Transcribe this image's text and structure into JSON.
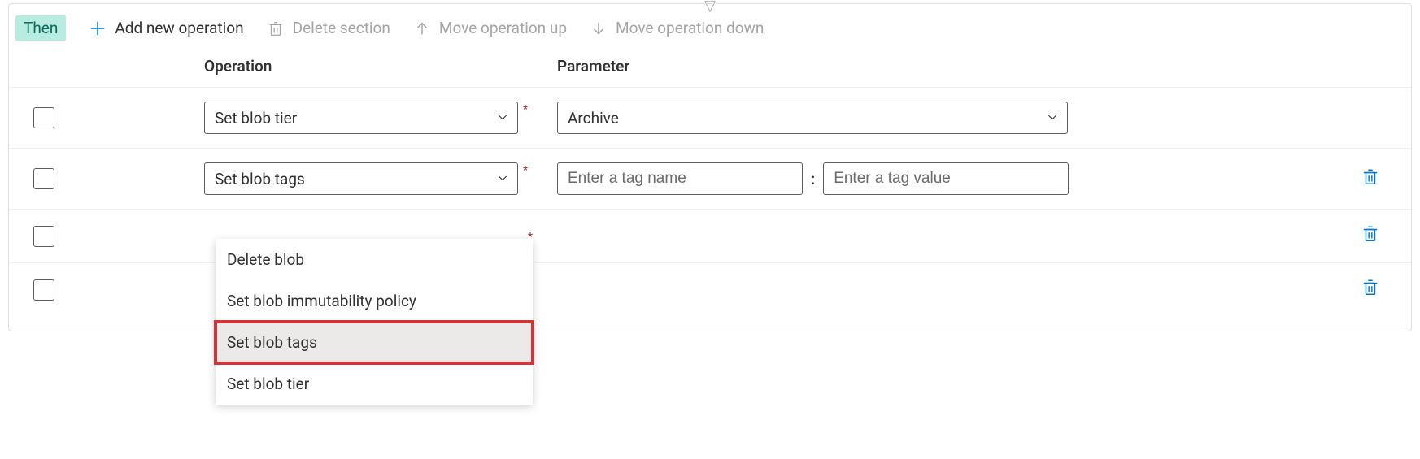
{
  "top_arrow_glyph": "▽",
  "badge": {
    "label": "Then"
  },
  "toolbar": {
    "add": {
      "label": "Add new operation"
    },
    "delete": {
      "label": "Delete section"
    },
    "moveup": {
      "label": "Move operation up"
    },
    "movedn": {
      "label": "Move operation down"
    }
  },
  "headers": {
    "operation": "Operation",
    "parameter": "Parameter"
  },
  "rows": [
    {
      "operation_selected": "Set blob tier",
      "parameter_kind": "select",
      "parameter_selected": "Archive",
      "show_trash": false
    },
    {
      "operation_selected": "Set blob tags",
      "parameter_kind": "tag",
      "tag_name_placeholder": "Enter a tag name",
      "tag_value_placeholder": "Enter a tag value",
      "tag_separator": ":",
      "show_trash": true
    },
    {
      "operation_selected": "",
      "parameter_kind": "none",
      "show_trash": true
    },
    {
      "operation_selected": "",
      "parameter_kind": "none",
      "show_trash": true
    }
  ],
  "dropdown": {
    "items": [
      {
        "label": "Delete blob",
        "highlight": false
      },
      {
        "label": "Set blob immutability policy",
        "highlight": false
      },
      {
        "label": "Set blob tags",
        "highlight": true
      },
      {
        "label": "Set blob tier",
        "highlight": false
      }
    ]
  },
  "required_mark": "*"
}
